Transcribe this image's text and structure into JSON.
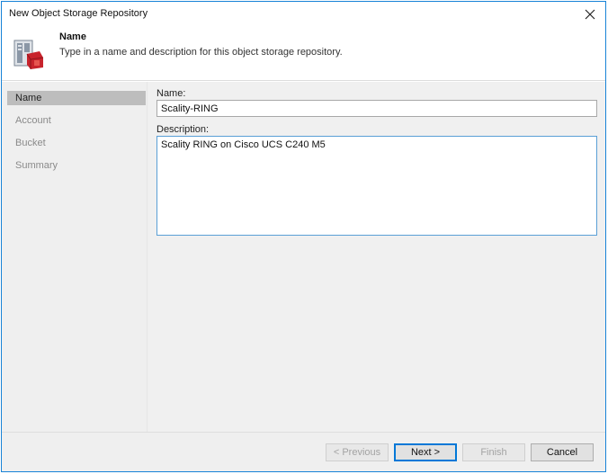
{
  "window": {
    "title": "New Object Storage Repository"
  },
  "header": {
    "title": "Name",
    "description": "Type in a name and description for this object storage repository."
  },
  "sidebar": {
    "items": [
      {
        "label": "Name"
      },
      {
        "label": "Account"
      },
      {
        "label": "Bucket"
      },
      {
        "label": "Summary"
      }
    ],
    "active": "Name"
  },
  "form": {
    "name_label": "Name:",
    "name_value": "Scality-RING",
    "description_label": "Description:",
    "description_value": "Scality RING on Cisco UCS C240 M5"
  },
  "footer": {
    "previous_label": "< Previous",
    "next_label": "Next >",
    "finish_label": "Finish",
    "cancel_label": "Cancel"
  },
  "icons": {
    "close": "close-icon",
    "wizard": "object-storage-icon"
  },
  "colors": {
    "accent": "#0078d7",
    "brand_red": "#d9302b",
    "active_nav_bg": "#bdbdbd"
  }
}
